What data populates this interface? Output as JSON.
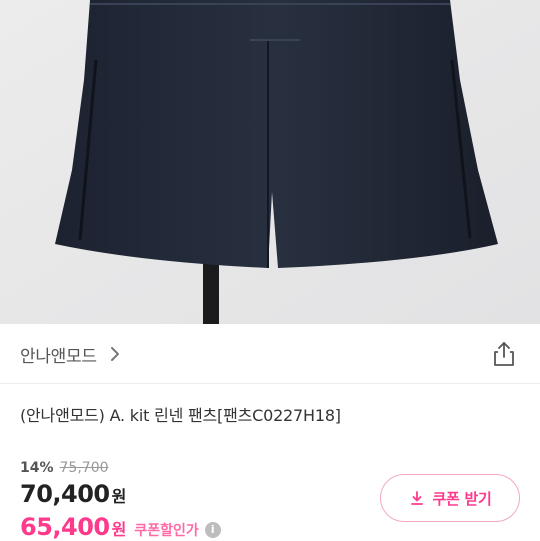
{
  "product_image": {
    "alt": "",
    "icon": "product-photo"
  },
  "store": {
    "name": "안나앤모드"
  },
  "product": {
    "title": "(안나앤모드) A. kit 린넨 팬츠[팬츠C0227H18]"
  },
  "pricing": {
    "discount_rate": "14%",
    "original_price": "75,700",
    "sale_price": "70,400",
    "currency": "원",
    "coupon_price": "65,400",
    "coupon_price_label": "쿠폰할인가",
    "info_glyph": "i"
  },
  "coupon_button": {
    "label": "쿠폰 받기"
  },
  "colors": {
    "accent": "#ff3a8c",
    "accent_border": "#f2a9c8",
    "text": "#222222",
    "muted": "#999999"
  }
}
